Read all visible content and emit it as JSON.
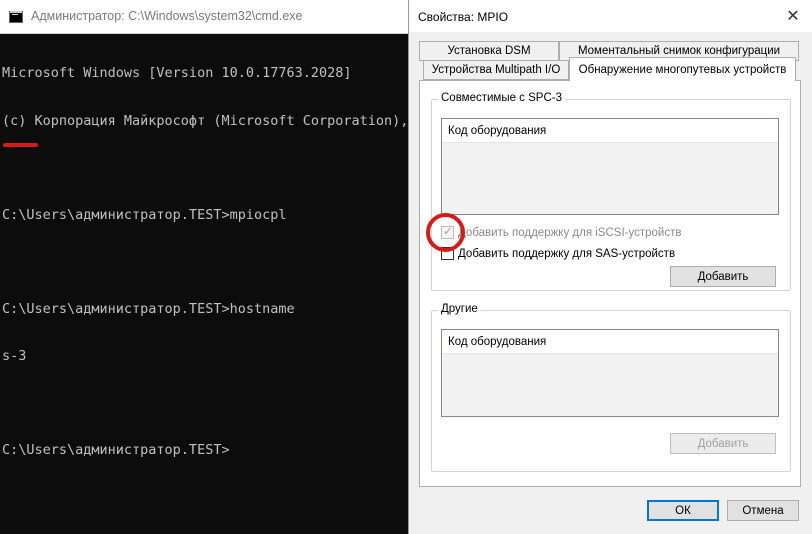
{
  "cmd": {
    "title": "Администратор: C:\\Windows\\system32\\cmd.exe",
    "lines": [
      "Microsoft Windows [Version 10.0.17763.2028]",
      "(c) Корпорация Майкрософт (Microsoft Corporation), ",
      "",
      "C:\\Users\\администратор.TEST>mpiocpl",
      "",
      "C:\\Users\\администратор.TEST>hostname",
      "s-3",
      "",
      "C:\\Users\\администратор.TEST>"
    ]
  },
  "dialog": {
    "title": "Свойства: MPIO",
    "close_icon": "close-icon",
    "tabs": {
      "dsm": "Установка DSM",
      "snapshot": "Моментальный снимок конфигурации",
      "devices": "Устройства Multipath I/O",
      "discover": "Обнаружение многопутевых устройств"
    },
    "spc3": {
      "group_label": "Совместимые с SPC-3",
      "list_header": "Код оборудования",
      "iscsi_label": "Добавить поддержку для iSCSI-устройств",
      "sas_label": "Добавить поддержку для SAS-устройств",
      "add_button": "Добавить"
    },
    "other": {
      "group_label": "Другие",
      "list_header": "Код оборудования",
      "add_button": "Добавить"
    },
    "ok_button": "ОК",
    "cancel_button": "Отмена"
  },
  "colors": {
    "annotation_red": "#d61919",
    "console_text": "#c0c0c0",
    "console_bg": "#0c0c0c",
    "focus_blue": "#0078d7"
  }
}
